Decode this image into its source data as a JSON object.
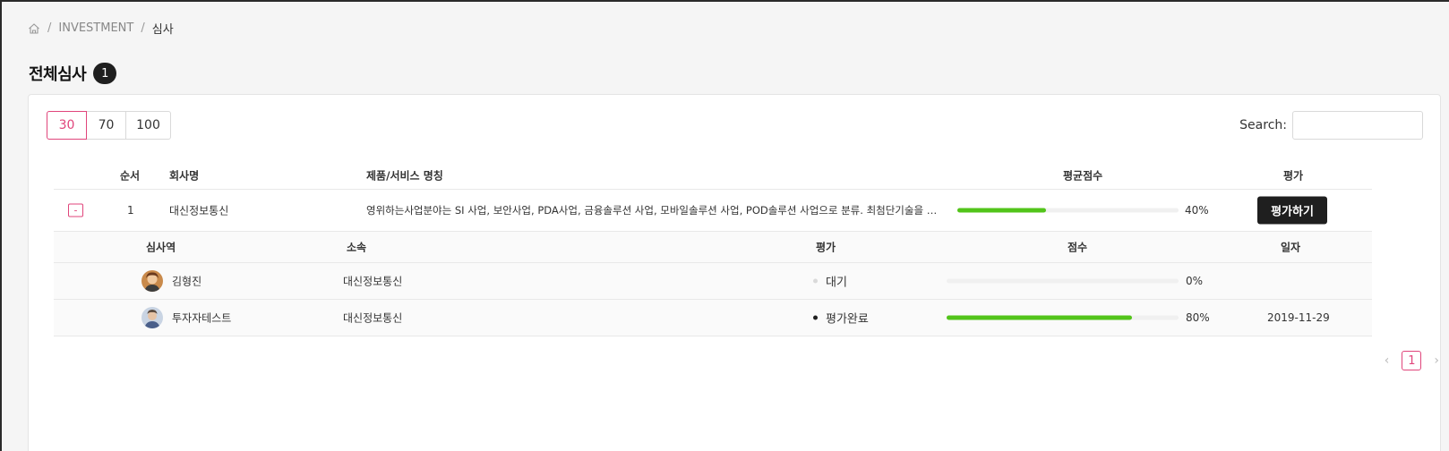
{
  "breadcrumb": {
    "items": [
      "INVESTMENT",
      "심사"
    ],
    "separator": "/"
  },
  "page": {
    "title": "전체심사",
    "count": "1"
  },
  "page_size": {
    "options": [
      "30",
      "70",
      "100"
    ],
    "selected": "30"
  },
  "search": {
    "label": "Search:",
    "value": ""
  },
  "table": {
    "headers": {
      "order": "순서",
      "company": "회사명",
      "product": "제품/서비스 명칭",
      "avg_score": "평균점수",
      "evaluate": "평가"
    },
    "rows": [
      {
        "toggle": "-",
        "order": "1",
        "company": "대신정보통신",
        "product": "영위하는사업분야는 SI 사업, 보안사업, PDA사업, 금융솔루션 사업, 모바일솔루션 사업, POD솔루션 사업으로 분류. 최첨단기술을 집적한 산업용 ...",
        "avg_score_pct": 40,
        "avg_score_label": "40%",
        "action": "평가하기"
      }
    ],
    "subtable": {
      "headers": {
        "reviewer": "심사역",
        "affiliation": "소속",
        "evaluation": "평가",
        "score": "점수",
        "date": "일자"
      },
      "rows": [
        {
          "name": "김형진",
          "affiliation": "대신정보통신",
          "status": "대기",
          "score_pct": 0,
          "score_label": "0%",
          "date": ""
        },
        {
          "name": "투자자테스트",
          "affiliation": "대신정보통신",
          "status": "평가완료",
          "score_pct": 80,
          "score_label": "80%",
          "date": "2019-11-29"
        }
      ]
    }
  },
  "pagination": {
    "prev": "‹",
    "current": "1",
    "next": "›"
  },
  "colors": {
    "accent": "#e0457b",
    "progress": "#52c41a",
    "dark": "#1f1f1f"
  }
}
